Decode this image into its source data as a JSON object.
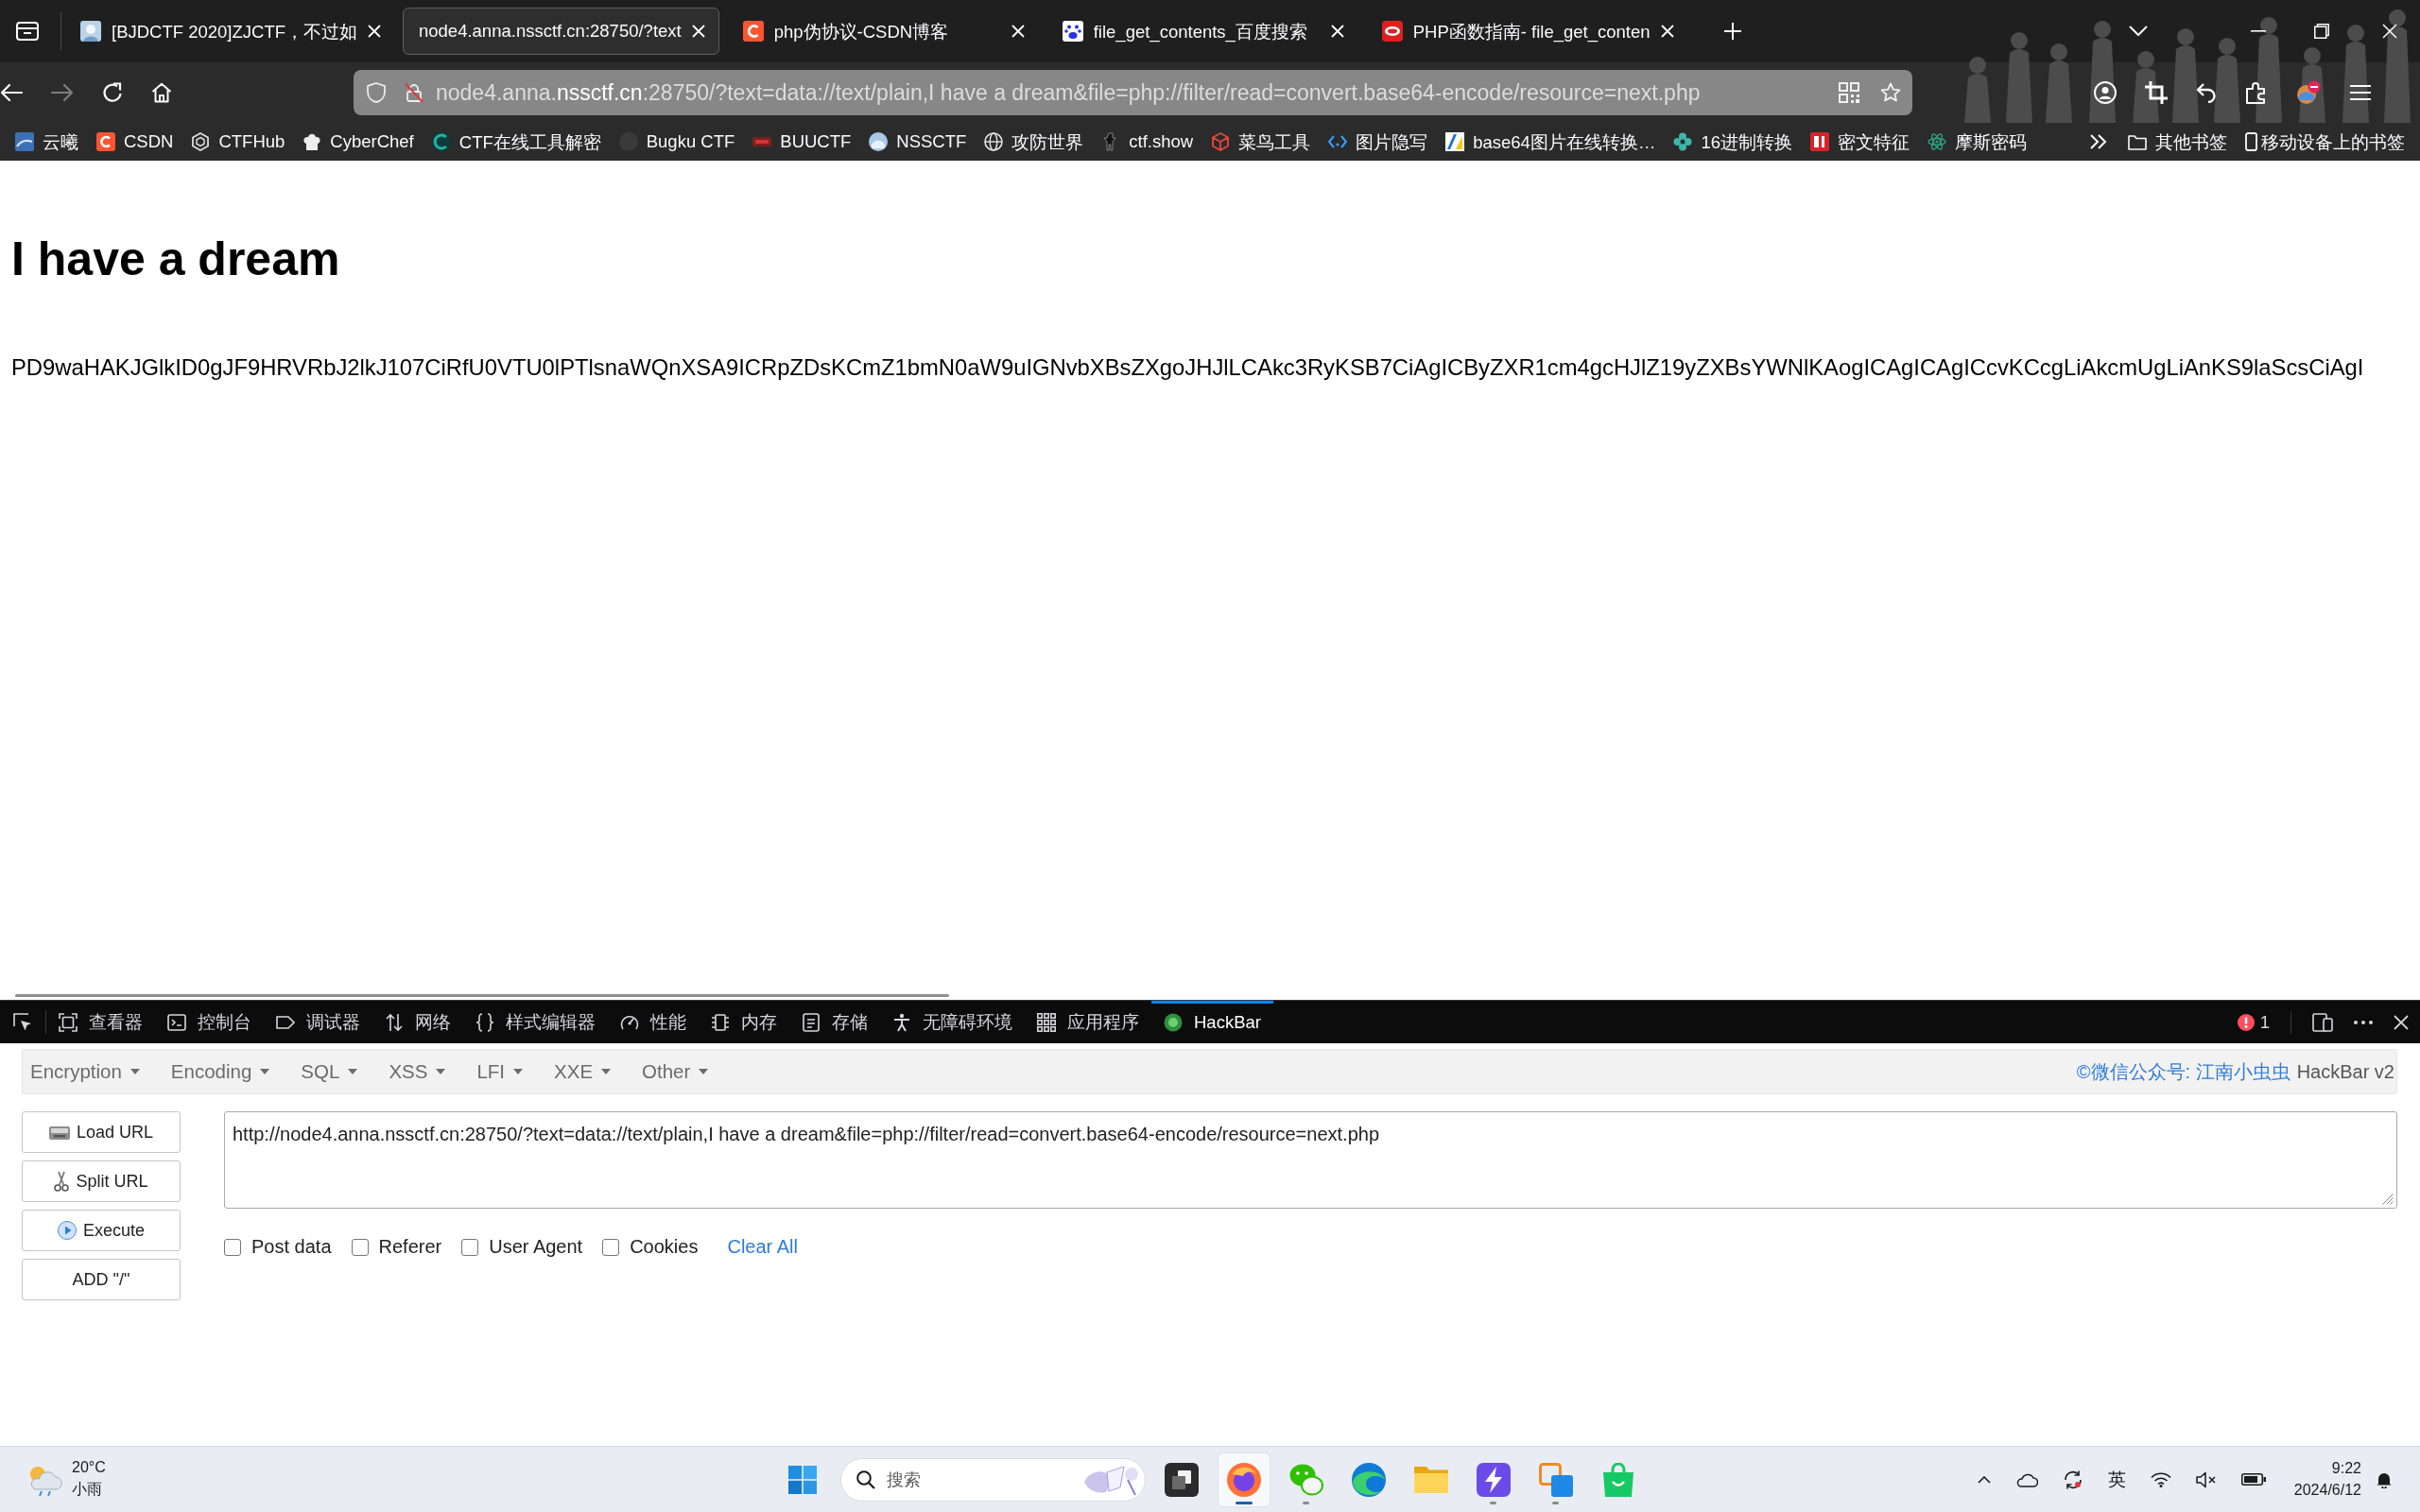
{
  "tabs": [
    {
      "title": "[BJDCTF 2020]ZJCTF，不过如",
      "selected": false
    },
    {
      "title": "node4.anna.nssctf.cn:28750/?text",
      "selected": true
    },
    {
      "title": "php伪协议-CSDN博客",
      "selected": false
    },
    {
      "title": "file_get_contents_百度搜索",
      "selected": false
    },
    {
      "title": "PHP函数指南- file_get_conten",
      "selected": false
    }
  ],
  "nav_buttons": [
    {
      "kind": "back",
      "disabled": false
    },
    {
      "kind": "forward",
      "disabled": true
    },
    {
      "kind": "reload",
      "disabled": false
    },
    {
      "kind": "home",
      "disabled": false
    }
  ],
  "address_bar": {
    "url_parts": [
      {
        "text": "node4.anna.",
        "highlight": false
      },
      {
        "text": "nssctf.cn",
        "highlight": true
      },
      {
        "text": ":28750/?text=data://text/plain,I have a dream&file=php://filter/read=convert.base64-encode/resource=next.php",
        "highlight": false
      }
    ]
  },
  "bookmarks": [
    {
      "label": "云曦"
    },
    {
      "label": "CSDN"
    },
    {
      "label": "CTFHub"
    },
    {
      "label": "CyberChef"
    },
    {
      "label": "CTF在线工具解密"
    },
    {
      "label": "Bugku CTF"
    },
    {
      "label": "BUUCTF"
    },
    {
      "label": "NSSCTF"
    },
    {
      "label": "攻防世界"
    },
    {
      "label": "ctf.show"
    },
    {
      "label": "菜鸟工具"
    },
    {
      "label": "图片隐写"
    },
    {
      "label": "base64图片在线转换…"
    },
    {
      "label": "16进制转换"
    },
    {
      "label": "密文特征"
    },
    {
      "label": "摩斯密码"
    }
  ],
  "other_bookmarks": "其他书签",
  "mobile_bookmarks": "移动设备上的书签",
  "page": {
    "heading": "I have a dream",
    "body_text": "PD9waHAKJGlkID0gJF9HRVRbJ2lkJ107CiRfU0VTU0lPTlsnaWQnXSA9ICRpZDsKCmZ1bmN0aW9uIGNvbXBsZXgoJHJlLCAkc3RyKSB7CiAgICByZXR1cm4gcHJlZ19yZXBsYWNlKAogICAgICAgICcvKCcgLiAkcmUgLiAnKS9laScsCiAgI"
  },
  "devtools": {
    "tools": [
      {
        "label": "查看器",
        "selected": false
      },
      {
        "label": "控制台",
        "selected": false
      },
      {
        "label": "调试器",
        "selected": false
      },
      {
        "label": "网络",
        "selected": false
      },
      {
        "label": "样式编辑器",
        "selected": false
      },
      {
        "label": "性能",
        "selected": false
      },
      {
        "label": "内存",
        "selected": false
      },
      {
        "label": "存储",
        "selected": false
      },
      {
        "label": "无障碍环境",
        "selected": false
      },
      {
        "label": "应用程序",
        "selected": false
      },
      {
        "label": "HackBar",
        "selected": true
      }
    ],
    "error_count": "1"
  },
  "hackbar": {
    "menus": [
      "Encryption",
      "Encoding",
      "SQL",
      "XSS",
      "LFI",
      "XXE",
      "Other"
    ],
    "credit": "©微信公众号: 江南小虫虫",
    "version": "HackBar v2",
    "buttons": [
      "Load URL",
      "Split URL",
      "Execute",
      "ADD \"/\""
    ],
    "url_value": "http://node4.anna.nssctf.cn:28750/?text=data://text/plain,I have a dream&file=php://filter/read=convert.base64-encode/resource=next.php",
    "options": [
      {
        "label": "Post data",
        "checked": false
      },
      {
        "label": "Referer",
        "checked": false
      },
      {
        "label": "User Agent",
        "checked": false
      },
      {
        "label": "Cookies",
        "checked": false
      }
    ],
    "clear_all": "Clear All"
  },
  "taskbar": {
    "weather": {
      "temperature": "20°C",
      "condition": "小雨"
    },
    "search_placeholder": "搜索",
    "apps": [
      {
        "selected": false,
        "running": false
      },
      {
        "selected": true,
        "running": true
      },
      {
        "selected": false,
        "running": true
      },
      {
        "selected": false,
        "running": false
      },
      {
        "selected": false,
        "running": false
      },
      {
        "selected": false,
        "running": true
      },
      {
        "selected": false,
        "running": true
      },
      {
        "selected": false,
        "running": false
      }
    ],
    "input_method": "英",
    "time": "9:22",
    "date": "2024/6/12"
  }
}
